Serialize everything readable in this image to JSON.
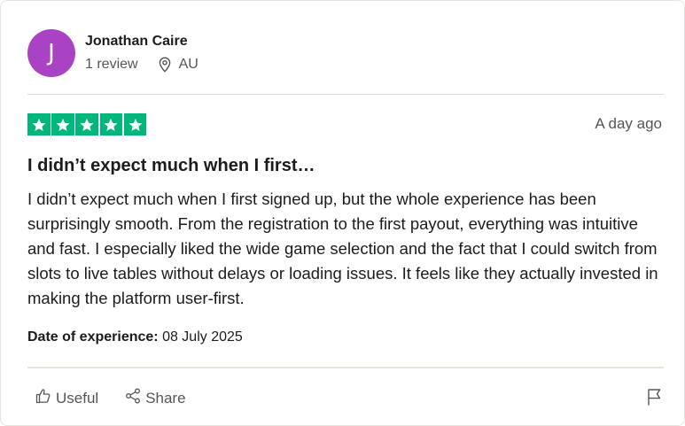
{
  "review": {
    "user": {
      "avatar_initial": "J",
      "avatar_color": "#a943c4",
      "name": "Jonathan Caire",
      "reviews_count": "1 review",
      "location": "AU"
    },
    "rating": {
      "stars": 5,
      "max": 5,
      "color": "#00b67a"
    },
    "posted": "A day ago",
    "title": "I didn’t expect much when I first…",
    "body": "I didn’t expect much when I first signed up, but the whole experience has been surprisingly smooth. From the registration to the first payout, everything was intuitive and fast. I especially liked the wide game selection and the fact that I could switch from slots to live tables without delays or loading issues. It feels like they actually invested in making the platform user-first.",
    "experience": {
      "label": "Date of experience:",
      "date": "08 July 2025"
    },
    "actions": {
      "useful": "Useful",
      "share": "Share"
    },
    "icons": [
      "location-pin-icon",
      "star-icon",
      "thumbs-up-icon",
      "share-icon",
      "flag-icon"
    ]
  }
}
